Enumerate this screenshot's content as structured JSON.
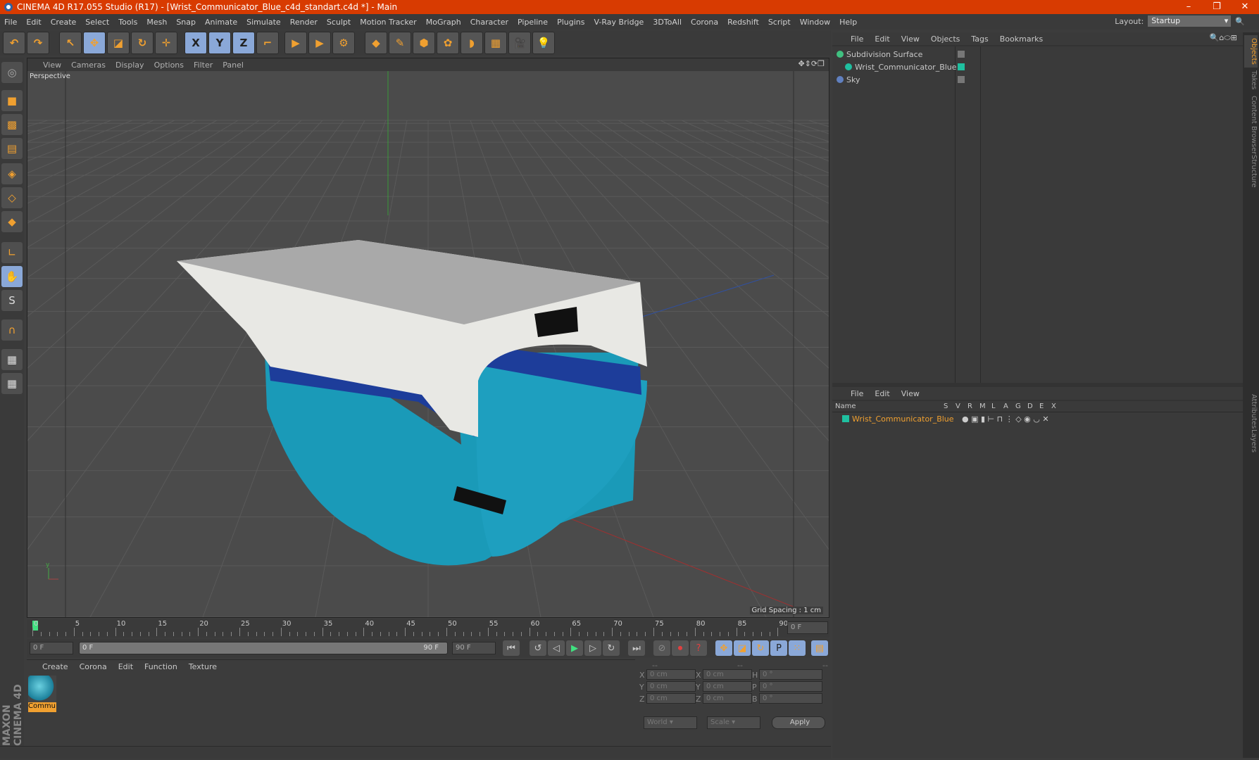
{
  "title": "CINEMA 4D R17.055 Studio (R17) - [Wrist_Communicator_Blue_c4d_standart.c4d *] - Main",
  "window_controls": {
    "minimize": "–",
    "restore": "❐",
    "close": "✕"
  },
  "menu": [
    "File",
    "Edit",
    "Create",
    "Select",
    "Tools",
    "Mesh",
    "Snap",
    "Animate",
    "Simulate",
    "Render",
    "Sculpt",
    "Motion Tracker",
    "MoGraph",
    "Character",
    "Pipeline",
    "Plugins",
    "V-Ray Bridge",
    "3DToAll",
    "Corona",
    "Redshift",
    "Script",
    "Window",
    "Help"
  ],
  "layout": {
    "label": "Layout:",
    "value": "Startup"
  },
  "toolbar": [
    {
      "icon": "undo-icon",
      "g": "↶"
    },
    {
      "icon": "redo-icon",
      "g": "↷"
    },
    {
      "icon": "select-icon",
      "g": "↖"
    },
    {
      "icon": "move-icon",
      "g": "✥",
      "active": true
    },
    {
      "icon": "scale-icon",
      "g": "◪"
    },
    {
      "icon": "rotate-icon",
      "g": "↻"
    },
    {
      "icon": "transform-icon",
      "g": "✛"
    },
    {
      "icon": "x-axis-icon",
      "g": "X",
      "active": true
    },
    {
      "icon": "y-axis-icon",
      "g": "Y",
      "active": true
    },
    {
      "icon": "z-axis-icon",
      "g": "Z",
      "active": true
    },
    {
      "icon": "coordinate-system-icon",
      "g": "⌐"
    },
    {
      "icon": "render-view-icon",
      "g": "▶"
    },
    {
      "icon": "render-picture-icon",
      "g": "▶"
    },
    {
      "icon": "render-settings-icon",
      "g": "⚙"
    },
    {
      "icon": "cube-icon",
      "g": "◆"
    },
    {
      "icon": "pen-icon",
      "g": "✎"
    },
    {
      "icon": "subdivision-icon",
      "g": "⬢"
    },
    {
      "icon": "array-icon",
      "g": "✿"
    },
    {
      "icon": "deformer-icon",
      "g": "◗"
    },
    {
      "icon": "floor-icon",
      "g": "▦"
    },
    {
      "icon": "camera-icon",
      "g": "🎥"
    },
    {
      "icon": "light-icon",
      "g": "💡"
    }
  ],
  "viewport": {
    "menu": [
      "View",
      "Cameras",
      "Display",
      "Options",
      "Filter",
      "Panel"
    ],
    "label": "Perspective",
    "grid_spacing": "Grid Spacing : 1 cm"
  },
  "objects_panel": {
    "menu": [
      "File",
      "Edit",
      "View",
      "Objects",
      "Tags",
      "Bookmarks"
    ],
    "items": [
      {
        "name": "Subdivision Surface",
        "color": "#40c080"
      },
      {
        "name": "Wrist_Communicator_Blue",
        "color": "#1fc0a0"
      },
      {
        "name": "Sky",
        "color": "#6080c0"
      }
    ]
  },
  "layers_panel": {
    "menu": [
      "File",
      "Edit",
      "View"
    ],
    "columns": [
      "Name",
      "S",
      "V",
      "R",
      "M",
      "L",
      "A",
      "G",
      "D",
      "E",
      "X"
    ],
    "items": [
      {
        "name": "Wrist_Communicator_Blue",
        "color": "#1fc0a0"
      }
    ]
  },
  "side_tabs": [
    "Objects",
    "Takes",
    "Content Browser",
    "Structure",
    "Attributes",
    "Layers"
  ],
  "timeline": {
    "ticks": [
      "0",
      "5",
      "10",
      "15",
      "20",
      "25",
      "30",
      "35",
      "40",
      "45",
      "50",
      "55",
      "60",
      "65",
      "70",
      "75",
      "80",
      "85",
      "90"
    ],
    "current": "0 F"
  },
  "controls": {
    "start": "0 F",
    "range_start": "0 F",
    "range_end": "90 F",
    "end": "90 F"
  },
  "materials": {
    "menu": [
      "Create",
      "Corona",
      "Edit",
      "Function",
      "Texture"
    ],
    "items": [
      {
        "name": "Commu"
      }
    ]
  },
  "coords": {
    "headers": [
      "--",
      "--",
      "--"
    ],
    "rows": [
      {
        "a": "X",
        "av": "0 cm",
        "b": "X",
        "bv": "0 cm",
        "c": "H",
        "cv": "0 °"
      },
      {
        "a": "Y",
        "av": "0 cm",
        "b": "Y",
        "bv": "0 cm",
        "c": "P",
        "cv": "0 °"
      },
      {
        "a": "Z",
        "av": "0 cm",
        "b": "Z",
        "bv": "0 cm",
        "c": "B",
        "cv": "0 °"
      }
    ],
    "world": "World",
    "scale": "Scale",
    "apply": "Apply"
  },
  "brand": "MAXON CINEMA 4D",
  "colors": {
    "title_bar": "#d83b01",
    "accent": "#f0a030",
    "object_teal": "#1fc0a0"
  }
}
